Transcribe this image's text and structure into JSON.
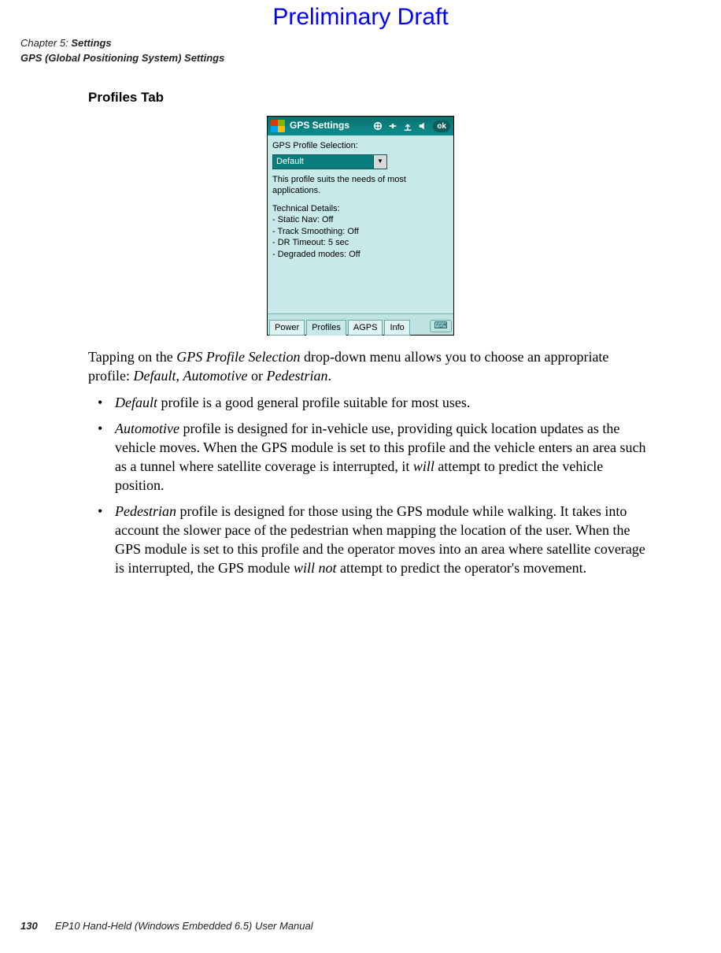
{
  "watermark": "Preliminary Draft",
  "header": {
    "line1_prefix": "Chapter 5: ",
    "line1_bold": "Settings",
    "line2": "GPS (Global Positioning System) Settings"
  },
  "heading": "Profiles Tab",
  "device": {
    "title": "GPS Settings",
    "ok": "ok",
    "label": "GPS Profile Selection:",
    "dropdown_value": "Default",
    "desc": "This profile suits the needs of most applications.",
    "tech_heading": "Technical Details:",
    "tech_items": [
      "- Static Nav: Off",
      "- Track Smoothing: Off",
      "- DR Timeout: 5 sec",
      "- Degraded modes: Off"
    ],
    "tabs": [
      "Power",
      "Profiles",
      "AGPS",
      "Info"
    ],
    "active_tab_index": 1
  },
  "body": {
    "intro_parts": [
      "Tapping on the ",
      "GPS Profile Selection",
      " drop-down menu allows you to choose an appropriate profile: ",
      "Default",
      ", ",
      "Automotive",
      " or ",
      "Pedestrian",
      "."
    ],
    "bullets": [
      {
        "lead": "Default",
        "rest": " profile is a good general profile suitable for most uses."
      },
      {
        "lead": "Automotive",
        "rest_a": " profile is designed for in-vehicle use, providing quick location updates as the vehicle moves. When the GPS module is set to this profile and the vehicle enters an area such as a tunnel where satellite coverage is interrupted, it ",
        "will": "will",
        "rest_b": " attempt to predict the vehicle position."
      },
      {
        "lead": "Pedestrian",
        "rest_a": " profile is designed for those using the GPS module while walking. It takes into account the slower pace of the pedestrian when mapping the location of the user. When the GPS module is set to this profile and the operator moves into an area where satellite coverage is interrupted, the GPS module ",
        "will": "will not",
        "rest_b": " attempt to predict the operator's movement."
      }
    ]
  },
  "footer": {
    "page": "130",
    "book": "EP10 Hand-Held (Windows Embedded 6.5) User Manual"
  }
}
